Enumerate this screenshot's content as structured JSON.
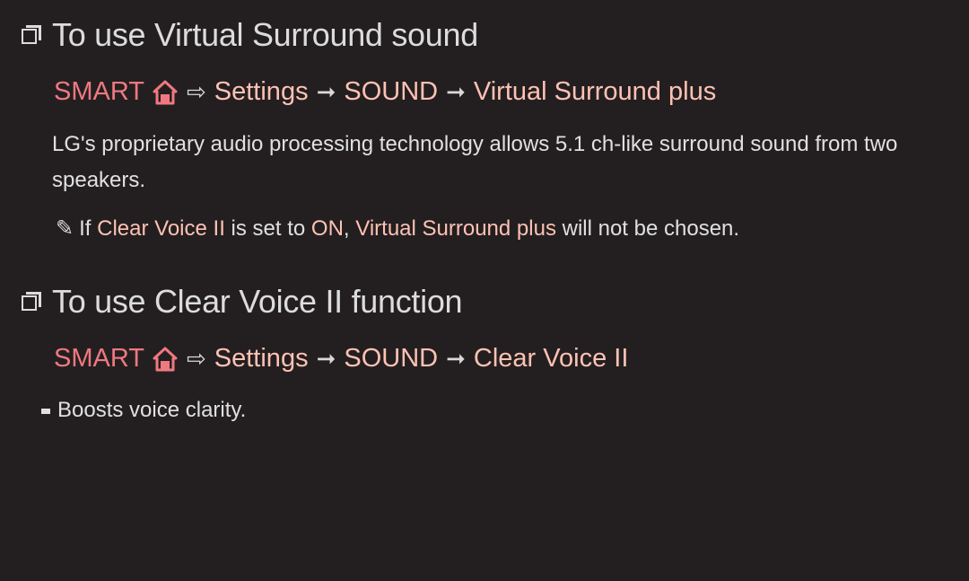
{
  "sections": [
    {
      "heading": "To use Virtual Surround sound",
      "path": {
        "smart": "SMART",
        "home_icon": "home-icon",
        "open_arrow": "⇨",
        "arrow": "➞",
        "steps": [
          "Settings",
          "SOUND",
          "Virtual Surround plus"
        ]
      },
      "description": "LG's proprietary audio processing technology allows 5.1 ch-like surround sound from two speakers.",
      "note": {
        "icon": "pencil-icon",
        "prefix": "If ",
        "hl1": "Clear Voice II",
        "mid1": " is set to ",
        "hl2": "ON",
        "mid2": ", ",
        "hl3": "Virtual Surround plus",
        "suffix": " will not be chosen."
      }
    },
    {
      "heading": "To use Clear Voice II function",
      "path": {
        "smart": "SMART",
        "home_icon": "home-icon",
        "open_arrow": "⇨",
        "arrow": "➞",
        "steps": [
          "Settings",
          "SOUND",
          "Clear Voice II"
        ]
      },
      "description": "Boosts voice clarity."
    }
  ],
  "colors": {
    "background": "#231f20",
    "smart": "#f07880",
    "crumb": "#ffc2b4",
    "text": "#e0e0e0"
  }
}
